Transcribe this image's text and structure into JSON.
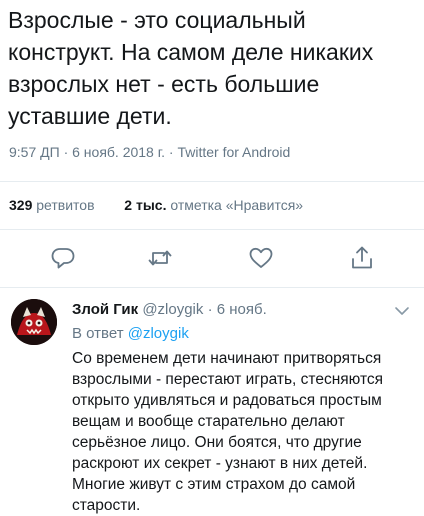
{
  "tweet": {
    "text": "Взрослые - это социальный конструкт. На самом деле никаких взрослых нет - есть большие уставшие дети.",
    "meta": "9:57 ДП · 6 нояб. 2018 г. · Twitter for Android"
  },
  "stats": {
    "retweets_count": "329",
    "retweets_label": "ретвитов",
    "likes_count": "2 тыс.",
    "likes_label": "отметка «Нравится»"
  },
  "actions": {
    "reply": "reply-icon",
    "retweet": "retweet-icon",
    "like": "heart-icon",
    "share": "share-icon"
  },
  "reply": {
    "name": "Злой Гик",
    "handle": "@zloygik",
    "date": "· 6 нояб.",
    "reply_to_prefix": "В ответ",
    "reply_to_handle": "@zloygik",
    "text": "Со временем дети начинают притворяться взрослыми - перестают играть, стесняются открыто удивляться и радоваться простым вещам и вообще старательно делают серьёзное лицо. Они боятся, что другие раскроют их секрет - узнают в них детей. Многие живут с этим страхом до самой старости."
  },
  "colors": {
    "text": "#14171a",
    "secondary": "#657786",
    "link": "#1da1f2",
    "divider": "#e6ecf0"
  }
}
